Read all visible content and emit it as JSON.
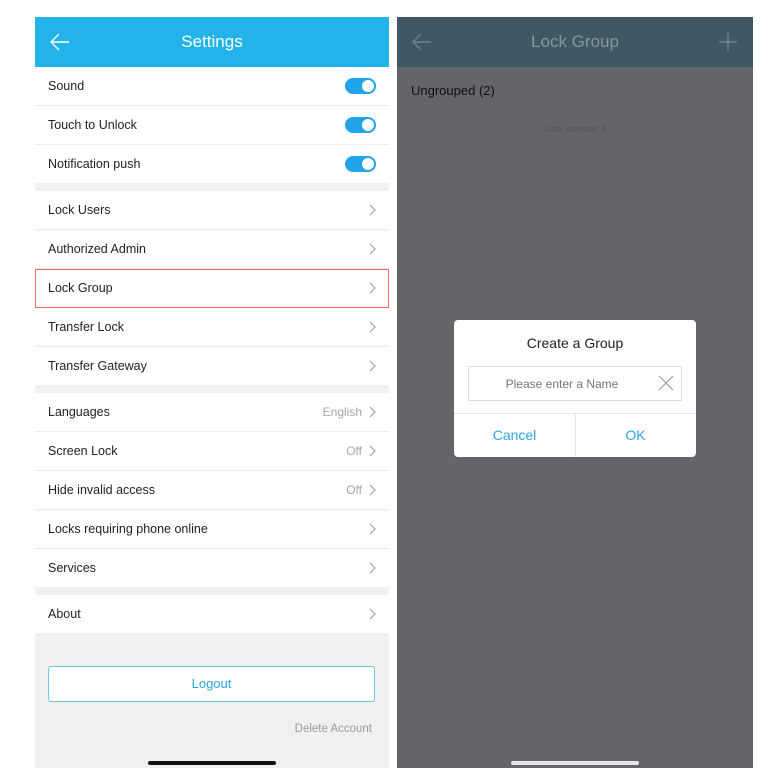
{
  "settings": {
    "title": "Settings",
    "toggles": [
      {
        "label": "Sound",
        "on": true
      },
      {
        "label": "Touch to Unlock",
        "on": true
      },
      {
        "label": "Notification push",
        "on": true
      }
    ],
    "manage": [
      {
        "label": "Lock Users"
      },
      {
        "label": "Authorized Admin"
      },
      {
        "label": "Lock Group"
      },
      {
        "label": "Transfer Lock"
      },
      {
        "label": "Transfer Gateway"
      }
    ],
    "prefs": [
      {
        "label": "Languages",
        "value": "English"
      },
      {
        "label": "Screen Lock",
        "value": "Off"
      },
      {
        "label": "Hide invalid access",
        "value": "Off"
      },
      {
        "label": "Locks requiring phone online",
        "value": ""
      },
      {
        "label": "Services",
        "value": ""
      }
    ],
    "about": {
      "label": "About"
    },
    "logout_label": "Logout",
    "delete_account_label": "Delete Account"
  },
  "lock_group": {
    "title": "Lock Group",
    "group_label": "Ungrouped",
    "group_count": "(2)",
    "lock_amount": "Lock amount: 2",
    "dialog": {
      "title": "Create a Group",
      "placeholder": "Please enter a Name",
      "cancel_label": "Cancel",
      "ok_label": "OK"
    }
  },
  "colors": {
    "settings_header": "#22b3ea",
    "lock_group_header": "#3f5866",
    "toggle_on": "#22a4ea",
    "highlight_border": "#ee6d5c",
    "overlay": "#63656a"
  },
  "icons": {
    "back": "arrow-left-icon",
    "add": "plus-icon",
    "chevron": "chevron-right-icon",
    "clear": "close-icon"
  }
}
